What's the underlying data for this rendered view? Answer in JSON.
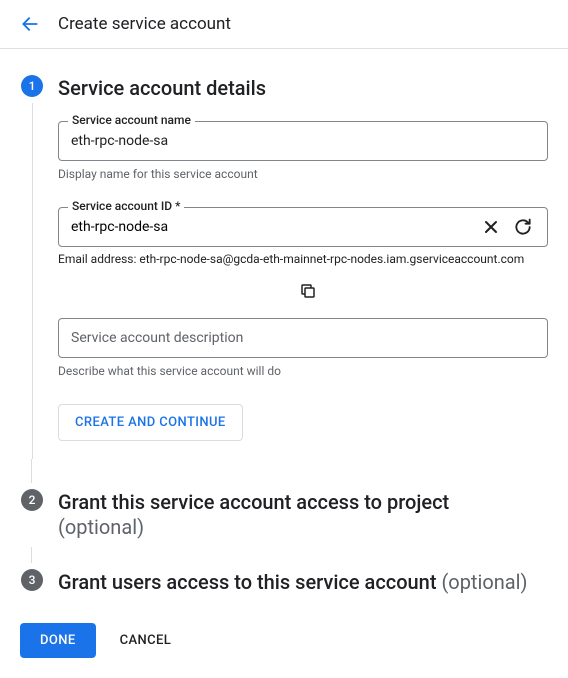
{
  "header": {
    "title": "Create service account"
  },
  "steps": {
    "s1": {
      "num": "1",
      "title": "Service account details",
      "name_label": "Service account name",
      "name_value": "eth-rpc-node-sa",
      "name_helper": "Display name for this service account",
      "id_label": "Service account ID *",
      "id_value": "eth-rpc-node-sa",
      "email_text": "Email address: eth-rpc-node-sa@gcda-eth-mainnet-rpc-nodes.iam.gserviceaccount.com",
      "desc_placeholder": "Service account description",
      "desc_helper": "Describe what this service account will do",
      "create_btn": "CREATE AND CONTINUE"
    },
    "s2": {
      "num": "2",
      "title": "Grant this service account access to project",
      "subtitle": "(optional)"
    },
    "s3": {
      "num": "3",
      "title": "Grant users access to this service account ",
      "subtitle": "(optional)"
    }
  },
  "footer": {
    "done": "DONE",
    "cancel": "CANCEL"
  }
}
